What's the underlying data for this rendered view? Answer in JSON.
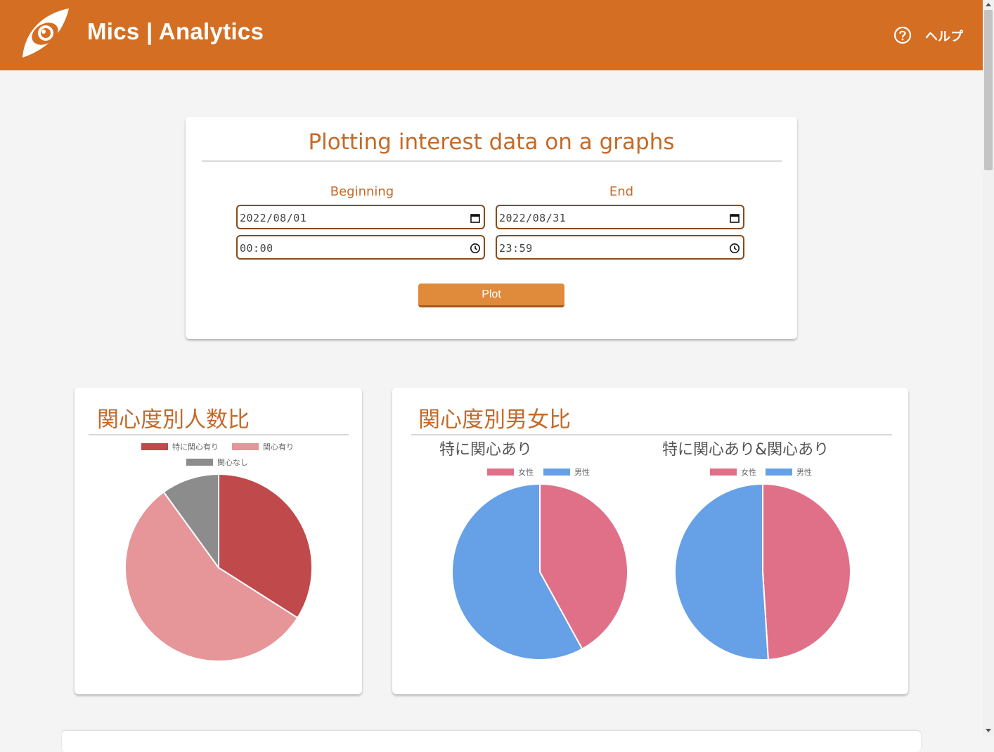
{
  "header": {
    "brand": "Mics | Analytics",
    "help_label": "ヘルプ",
    "logo_icon": "eye-logo-icon",
    "help_icon": "question-circle-icon",
    "color": "#d46e22"
  },
  "form": {
    "title": "Plotting interest data on a graphs",
    "beginning_label": "Beginning",
    "end_label": "End",
    "begin_date": "2022/08/01",
    "end_date": "2022/08/31",
    "begin_time": "00:00",
    "end_time": "23:59",
    "plot_label": "Plot"
  },
  "charts": {
    "interest": {
      "title": "関心度別人数比"
    },
    "gender": {
      "title": "関心度別男女比",
      "left_subtitle": "特に関心あり",
      "right_subtitle": "特に関心あり&関心あり"
    }
  },
  "chart_data": [
    {
      "type": "pie",
      "categories": [
        "特に関心有り",
        "関心有り",
        "関心なし"
      ],
      "values": [
        34,
        56,
        10
      ],
      "colors": [
        "#c0494b",
        "#e69599",
        "#8c8c8c"
      ],
      "legend": "top"
    },
    {
      "type": "pie",
      "title": "特に関心あり",
      "categories": [
        "女性",
        "男性"
      ],
      "values": [
        42,
        58
      ],
      "colors": [
        "#e07088",
        "#66a0e6"
      ],
      "legend": "top"
    },
    {
      "type": "pie",
      "title": "特に関心あり&関心あり",
      "categories": [
        "女性",
        "男性"
      ],
      "values": [
        49,
        51
      ],
      "colors": [
        "#e07088",
        "#66a0e6"
      ],
      "legend": "top"
    }
  ]
}
